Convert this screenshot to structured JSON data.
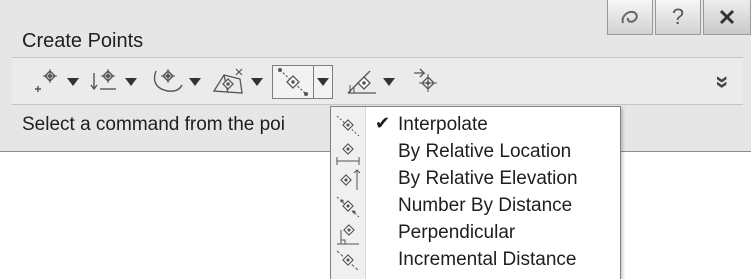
{
  "window": {
    "title": "Create Points",
    "buttons": {
      "pin": "ℰ",
      "help": "?",
      "close": "✖"
    }
  },
  "toolbar": {
    "tools": [
      {
        "icon": "miscellaneous-point-icon"
      },
      {
        "icon": "elevation-point-icon"
      },
      {
        "icon": "alignment-point-icon"
      },
      {
        "icon": "surface-point-icon"
      },
      {
        "icon": "interpolate-point-icon",
        "active": true
      },
      {
        "icon": "slope-point-icon"
      },
      {
        "icon": "convert-point-icon"
      }
    ],
    "overflow_glyph": "»"
  },
  "status": {
    "text": "Select a command from the poi"
  },
  "menu": {
    "items": [
      {
        "label": "Interpolate",
        "checked": true,
        "check_glyph": "✔"
      },
      {
        "label": "By Relative Location",
        "checked": false
      },
      {
        "label": "By Relative Elevation",
        "checked": false
      },
      {
        "label": "Number By Distance",
        "checked": false
      },
      {
        "label": "Perpendicular",
        "checked": false
      },
      {
        "label": "Incremental Distance",
        "checked": false
      }
    ]
  }
}
